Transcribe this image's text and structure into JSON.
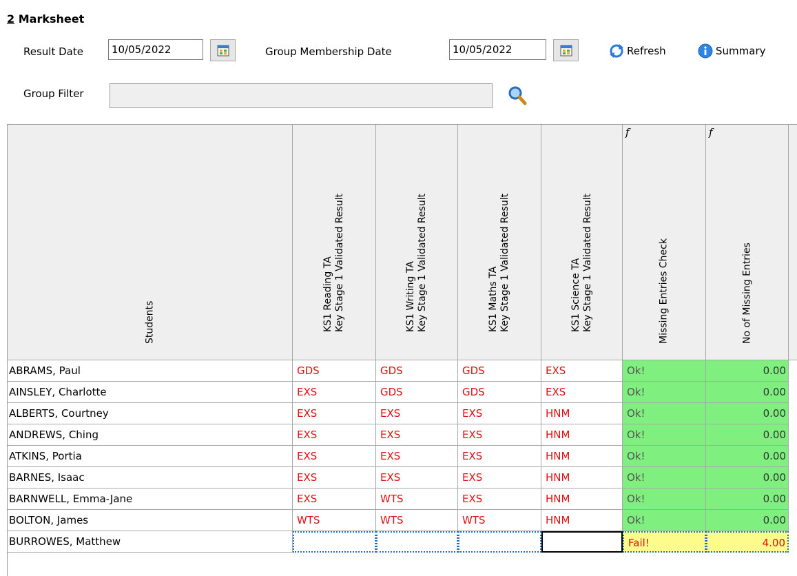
{
  "panel": {
    "accel": "2",
    "title": "Marksheet"
  },
  "filters": {
    "result_date_label": "Result Date",
    "result_date": "10/05/2022",
    "group_membership_label": "Group Membership Date",
    "group_membership_date": "10/05/2022",
    "refresh_label": "Refresh",
    "summary_label": "Summary",
    "group_filter_label": "Group Filter",
    "group_filter_value": ""
  },
  "icons": [
    "calendar-icon",
    "refresh-icon",
    "info-icon",
    "magnifier-icon"
  ],
  "colors": {
    "result_text": "#e01010",
    "ok_fill": "#7ff07f",
    "fail_fill": "#fdfb8a",
    "header_fill": "#efefef",
    "selection_border": "#1a6fd1"
  },
  "grid": {
    "columns": [
      {
        "key": "students",
        "label": "Students"
      },
      {
        "key": "reading",
        "label1": "KS1 Reading TA",
        "label2": "Key Stage 1 Validated Result"
      },
      {
        "key": "writing",
        "label1": "KS1 Writing TA",
        "label2": "Key Stage 1 Validated Result"
      },
      {
        "key": "maths",
        "label1": "KS1 Maths TA",
        "label2": "Key Stage 1 Validated Result"
      },
      {
        "key": "science",
        "label1": "KS1 Science TA",
        "label2": "Key Stage 1 Validated Result"
      },
      {
        "key": "missing_check",
        "label": "Missing Entries Check",
        "formula_mark": "f"
      },
      {
        "key": "missing_count",
        "label": "No of Missing Entries",
        "formula_mark": "f"
      }
    ],
    "rows": [
      {
        "name": "ABRAMS, Paul",
        "reading": "GDS",
        "writing": "GDS",
        "maths": "GDS",
        "science": "EXS",
        "check": "Ok!",
        "missing": "0.00"
      },
      {
        "name": "AINSLEY, Charlotte",
        "reading": "EXS",
        "writing": "GDS",
        "maths": "GDS",
        "science": "EXS",
        "check": "Ok!",
        "missing": "0.00"
      },
      {
        "name": "ALBERTS, Courtney",
        "reading": "EXS",
        "writing": "EXS",
        "maths": "EXS",
        "science": "HNM",
        "check": "Ok!",
        "missing": "0.00"
      },
      {
        "name": "ANDREWS, Ching",
        "reading": "EXS",
        "writing": "EXS",
        "maths": "EXS",
        "science": "HNM",
        "check": "Ok!",
        "missing": "0.00"
      },
      {
        "name": "ATKINS, Portia",
        "reading": "EXS",
        "writing": "EXS",
        "maths": "EXS",
        "science": "HNM",
        "check": "Ok!",
        "missing": "0.00"
      },
      {
        "name": "BARNES, Isaac",
        "reading": "EXS",
        "writing": "EXS",
        "maths": "EXS",
        "science": "HNM",
        "check": "Ok!",
        "missing": "0.00"
      },
      {
        "name": "BARNWELL, Emma-Jane",
        "reading": "EXS",
        "writing": "WTS",
        "maths": "EXS",
        "science": "HNM",
        "check": "Ok!",
        "missing": "0.00"
      },
      {
        "name": "BOLTON, James",
        "reading": "WTS",
        "writing": "WTS",
        "maths": "WTS",
        "science": "HNM",
        "check": "Ok!",
        "missing": "0.00"
      },
      {
        "name": "BURROWES, Matthew",
        "reading": "",
        "writing": "",
        "maths": "",
        "science": "",
        "check": "Fail!",
        "missing": "4.00"
      }
    ]
  }
}
